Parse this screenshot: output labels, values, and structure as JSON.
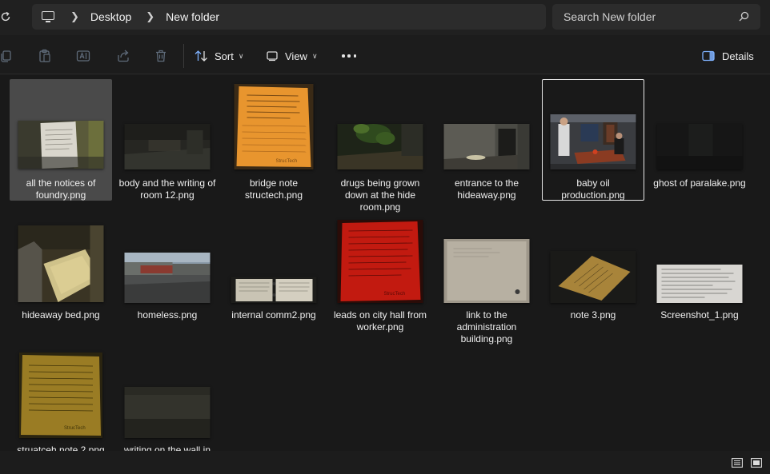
{
  "breadcrumbs": [
    "Desktop",
    "New folder"
  ],
  "search": {
    "placeholder": "Search New folder"
  },
  "toolbar": {
    "sort_label": "Sort",
    "view_label": "View",
    "details_label": "Details"
  },
  "files": [
    {
      "name": "all the notices of foundry.png",
      "selected": true,
      "thumb": "note-corridor"
    },
    {
      "name": "body and the writing of room 12.png",
      "thumb": "dark-room"
    },
    {
      "name": "bridge note structech.png",
      "thumb": "orange-note"
    },
    {
      "name": "drugs being grown down at the hide room.png",
      "thumb": "plants"
    },
    {
      "name": "entrance to the hideaway.png",
      "thumb": "hideaway-entrance"
    },
    {
      "name": "baby oil production.png",
      "focused": true,
      "thumb": "office"
    },
    {
      "name": "ghost of paralake.png",
      "thumb": "dark"
    },
    {
      "name": "hideaway bed.png",
      "thumb": "bed"
    },
    {
      "name": "homeless.png",
      "thumb": "street"
    },
    {
      "name": "internal comm2.png",
      "thumb": "binder"
    },
    {
      "name": "leads on city hall from worker.png",
      "thumb": "red-note"
    },
    {
      "name": "link to the administration building.png",
      "thumb": "paper"
    },
    {
      "name": "note 3.png",
      "thumb": "note-tilted"
    },
    {
      "name": "Screenshot_1.png",
      "thumb": "text-doc"
    },
    {
      "name": "struatceh note 2.png",
      "thumb": "yellow-note"
    },
    {
      "name": "writing on the wall in",
      "thumb": "wall"
    }
  ]
}
